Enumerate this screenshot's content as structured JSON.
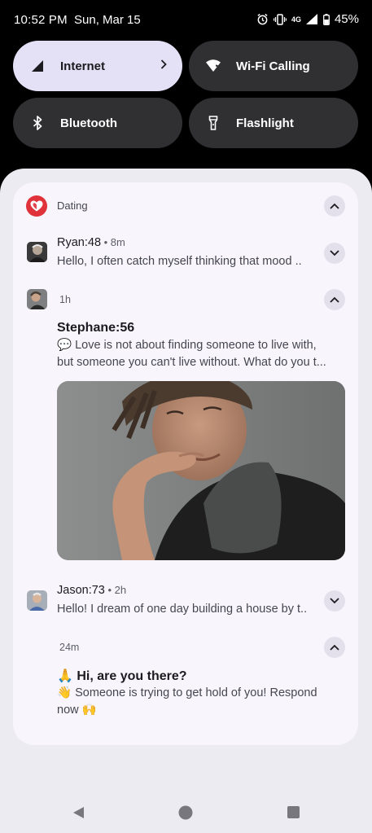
{
  "status_bar": {
    "time": "10:52 PM",
    "date": "Sun, Mar 15",
    "network": "4G",
    "battery": "45%"
  },
  "quick_settings": {
    "internet": "Internet",
    "wifi_calling": "Wi-Fi Calling",
    "bluetooth": "Bluetooth",
    "flashlight": "Flashlight"
  },
  "notification": {
    "app_name": "Dating",
    "messages": [
      {
        "sender": "Ryan:48",
        "time": "8m",
        "text": "Hello, I often catch myself thinking that mood .."
      },
      {
        "time": "1h",
        "sender": "Stephane:56",
        "text": "💬 Love is not about finding someone to live with, but someone you can't live without. What do you t..."
      },
      {
        "sender": "Jason:73",
        "time": "2h",
        "text": "Hello! I dream of one day building a house by t.."
      },
      {
        "time": "24m",
        "title": "🙏 Hi, are you there?",
        "text": "👋 Someone is trying to get hold of you! Respond now 🙌"
      }
    ]
  },
  "colors": {
    "tile_on": "#e4e1f6",
    "tile_off": "#303033",
    "brand": "#e0323a"
  }
}
